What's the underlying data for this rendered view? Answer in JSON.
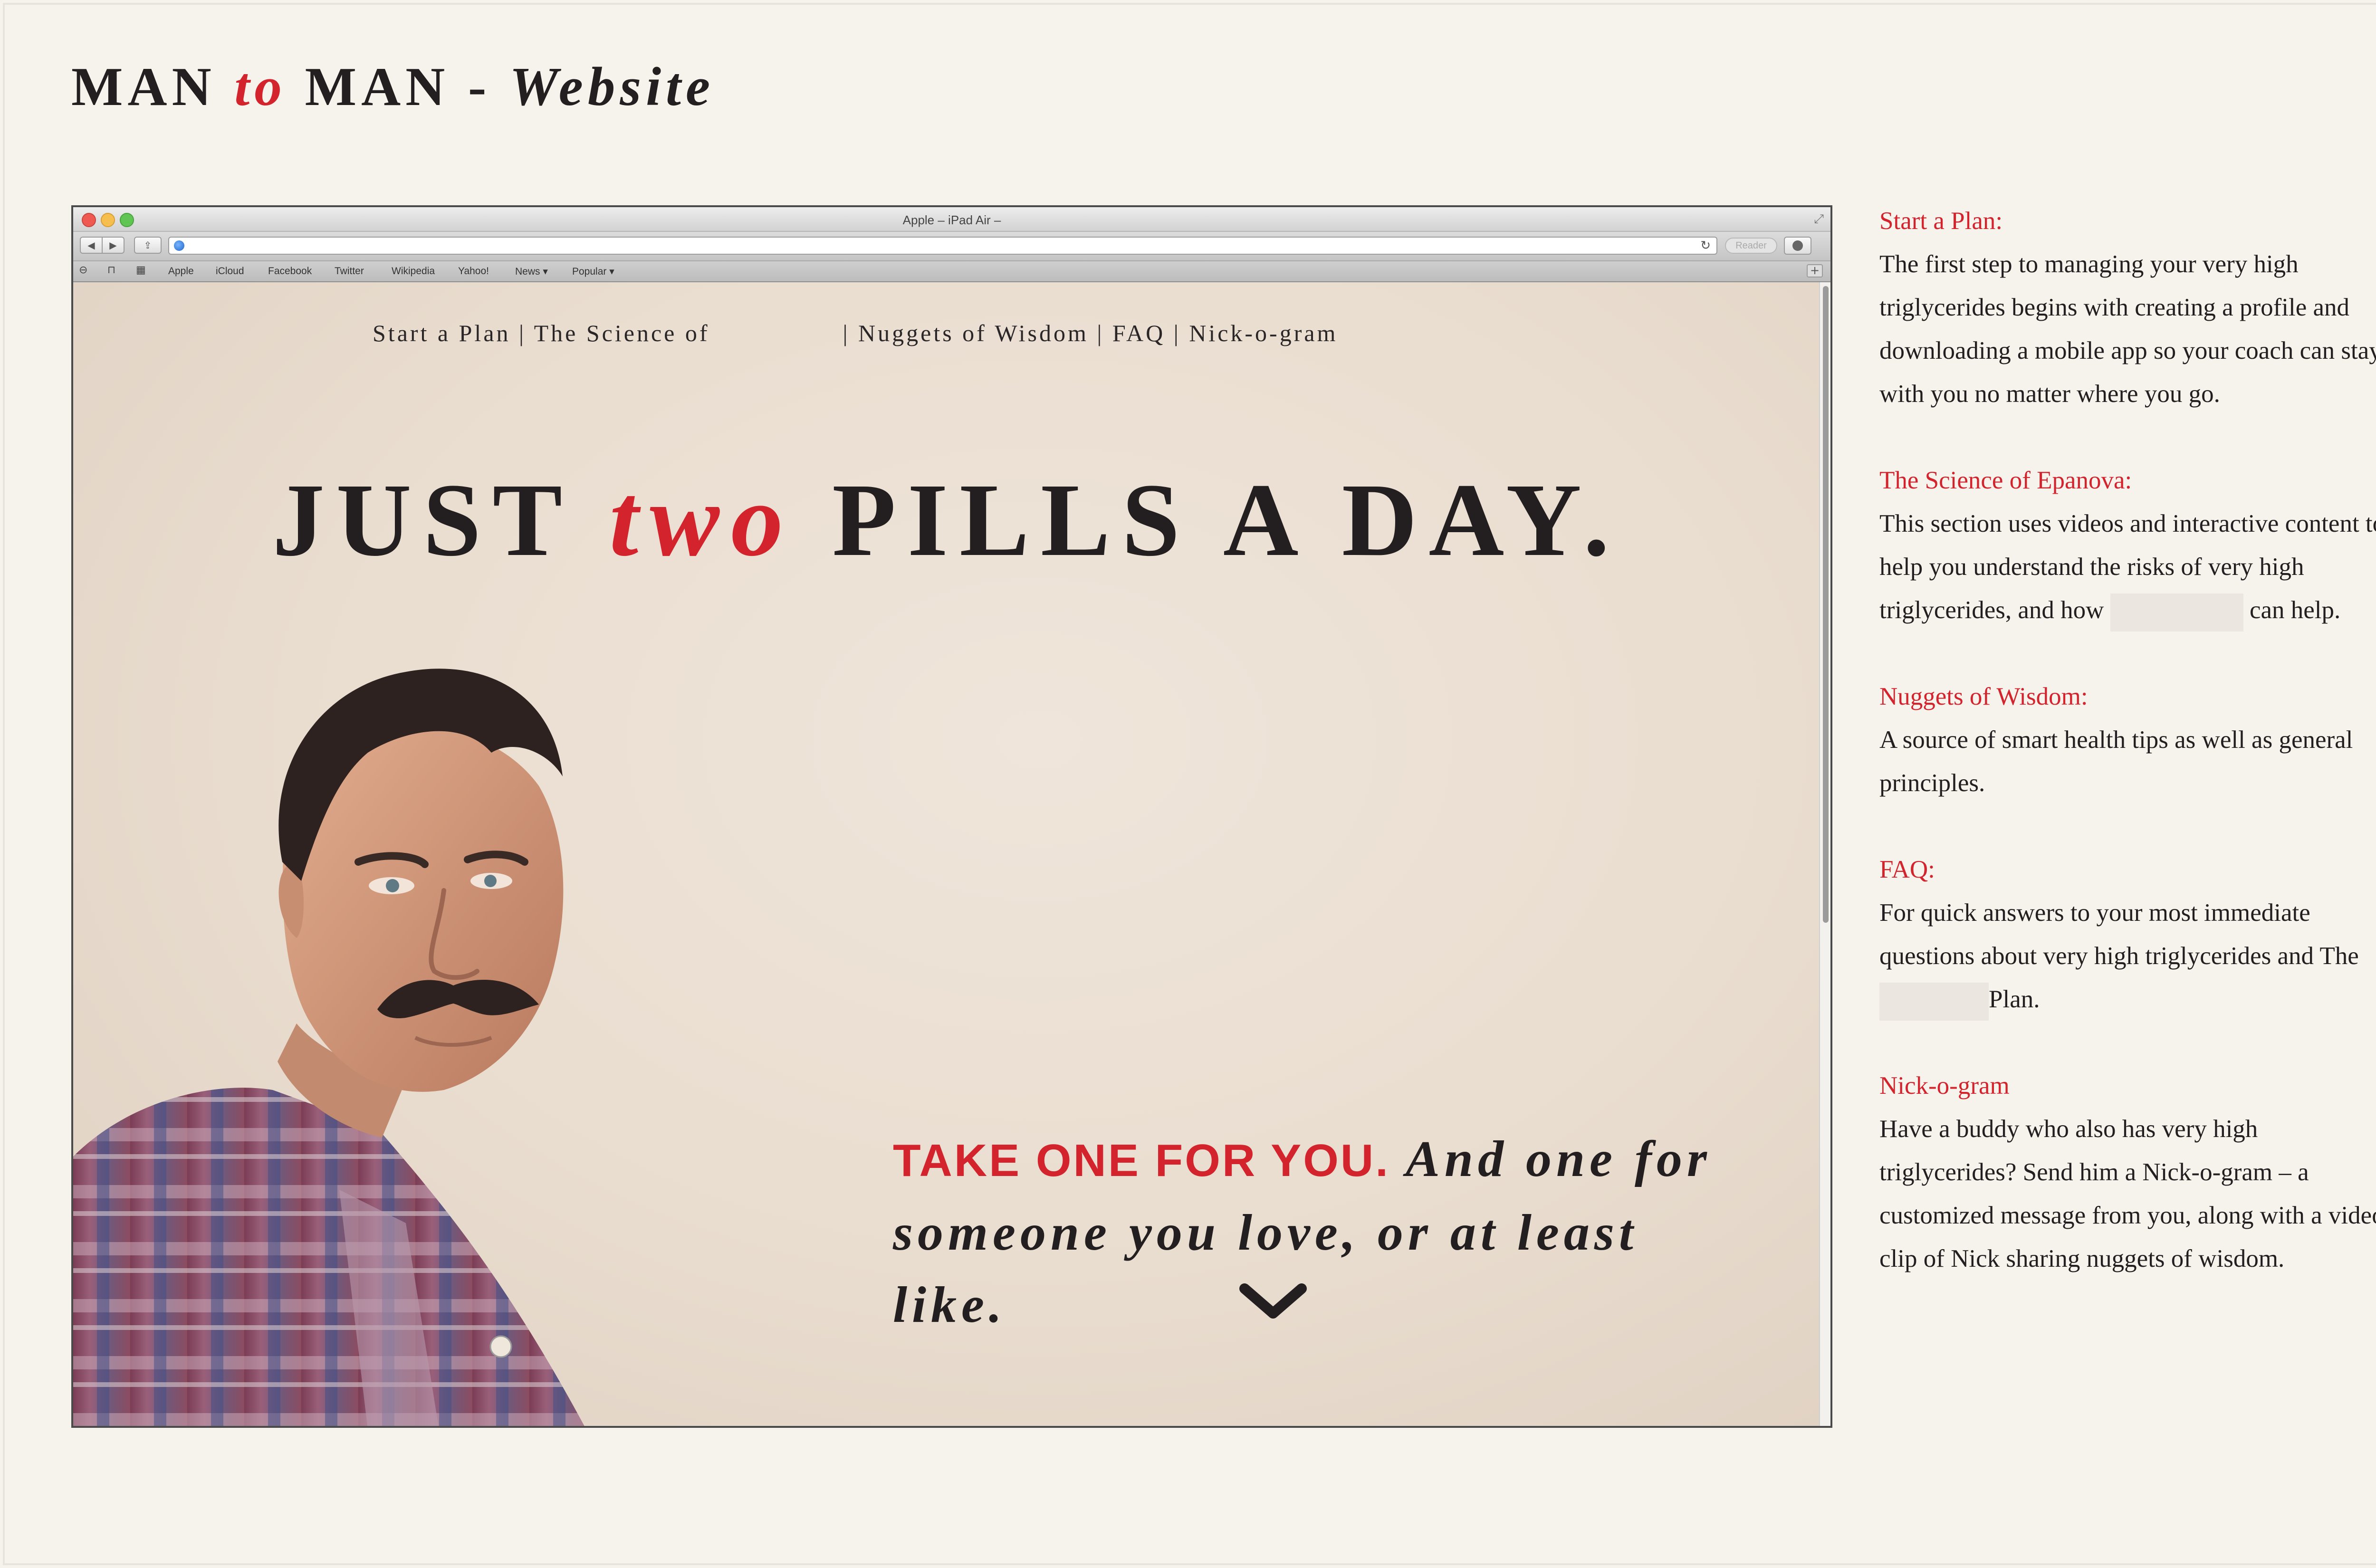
{
  "page_title": {
    "part1": "MAN ",
    "part2": "to",
    "part3": " MAN",
    "part4": " - ",
    "part5": "Website"
  },
  "browser": {
    "window_title": "Apple – iPad Air –",
    "reader_label": "Reader",
    "bookmarks": [
      "Apple",
      "iCloud",
      "Facebook",
      "Twitter",
      "Wikipedia",
      "Yahoo!",
      "News ▾",
      "Popular ▾"
    ]
  },
  "site": {
    "nav": {
      "start_plan": "Start a Plan",
      "sep1": " | ",
      "science": "The Science of",
      "sep2": "| ",
      "nuggets": "Nuggets of Wisdom",
      "sep3": " | ",
      "faq": "FAQ",
      "sep4": " | ",
      "nickogram": "Nick-o-gram"
    },
    "headline": {
      "part1": "JUST ",
      "part2": "two",
      "part3": " PILLS A DAY."
    },
    "tagline": {
      "red": "TAKE ONE FOR YOU.",
      "rest": " And one for someone you love, or at least like."
    }
  },
  "sidebar": {
    "start_plan": {
      "heading": "Start a Plan:",
      "body": "The first step to managing your very high triglycerides begins with creating a profile and downloading a mobile app so your coach can stay with you no matter where you go."
    },
    "science": {
      "heading": "The Science of Epanova:",
      "body1": "This section uses videos and interactive content to help you understand the risks of very high triglycerides, and how",
      "body2": "can help."
    },
    "nuggets": {
      "heading": "Nuggets of Wisdom:",
      "body": "A source of smart health tips as well as general principles."
    },
    "faq": {
      "heading": "FAQ:",
      "body1": "For quick answers to your most immediate questions about very high triglycerides and The",
      "body2": "Plan."
    },
    "nickogram": {
      "heading": "Nick-o-gram",
      "body": "Have a buddy who also has very high triglycerides? Send him a Nick-o-gram – a customized message from you, along with a video clip of Nick sharing nuggets of wisdom."
    }
  },
  "colors": {
    "accent_red": "#d3232c",
    "text_dark": "#231f20",
    "page_bg": "#f6f2ec"
  }
}
